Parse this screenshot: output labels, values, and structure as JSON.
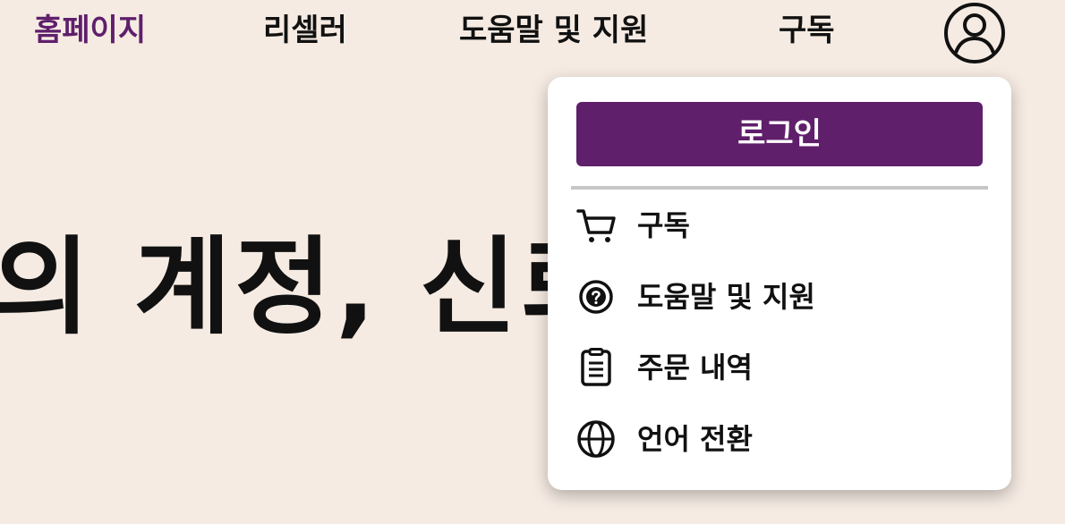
{
  "nav": {
    "home": "홈페이지",
    "reseller": "리셀러",
    "help": "도움말 및 지원",
    "subscribe": "구독"
  },
  "hero": {
    "title_fragment": "의 계정, 신뢰"
  },
  "account_menu": {
    "login_label": "로그인",
    "items": [
      {
        "label": "구독",
        "icon": "cart-icon"
      },
      {
        "label": "도움말 및 지원",
        "icon": "help-circle-icon"
      },
      {
        "label": "주문 내역",
        "icon": "clipboard-icon"
      },
      {
        "label": "언어 전환",
        "icon": "globe-icon"
      }
    ]
  },
  "colors": {
    "background": "#f5ebe3",
    "accent": "#5f1f6b",
    "text": "#111111",
    "menu_bg": "#ffffff",
    "divider": "#c6c6c6"
  }
}
